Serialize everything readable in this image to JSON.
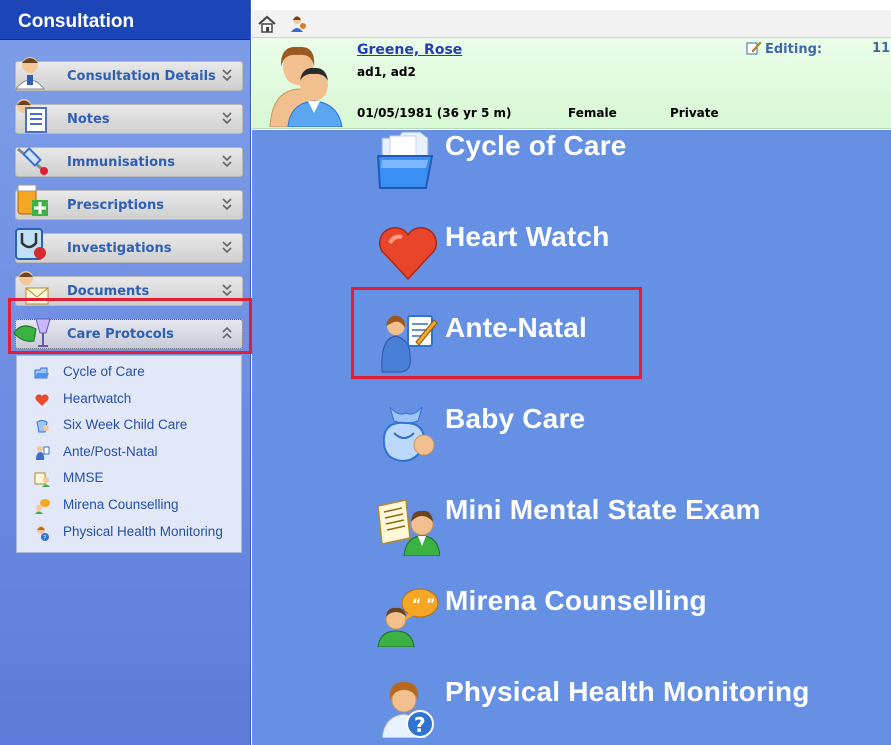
{
  "sidebar": {
    "title": "Consultation",
    "items": [
      {
        "label": "Consultation Details",
        "icon": "doctor-icon"
      },
      {
        "label": "Notes",
        "icon": "notes-icon"
      },
      {
        "label": "Immunisations",
        "icon": "syringe-icon"
      },
      {
        "label": "Prescriptions",
        "icon": "prescription-icon"
      },
      {
        "label": "Investigations",
        "icon": "stethoscope-icon"
      },
      {
        "label": "Documents",
        "icon": "documents-icon"
      },
      {
        "label": "Care Protocols",
        "icon": "care-protocols-icon",
        "expanded": true
      }
    ],
    "care_protocols": [
      {
        "label": "Cycle of Care",
        "icon": "folder-icon"
      },
      {
        "label": "Heartwatch",
        "icon": "heart-icon"
      },
      {
        "label": "Six Week Child Care",
        "icon": "baby-icon"
      },
      {
        "label": "Ante/Post-Natal",
        "icon": "mother-icon"
      },
      {
        "label": "MMSE",
        "icon": "exam-icon"
      },
      {
        "label": "Mirena Counselling",
        "icon": "speech-icon"
      },
      {
        "label": "Physical Health Monitoring",
        "icon": "health-help-icon"
      }
    ]
  },
  "toolbar": {
    "icons": [
      "home-icon",
      "patient-icon"
    ]
  },
  "patient": {
    "name": "Greene, Rose",
    "address": "ad1, ad2",
    "dob": "01/05/1981 (36 yr 5 m)",
    "sex": "Female",
    "billing": "Private",
    "editing_label": "Editing:",
    "editing_value": "11"
  },
  "protocols": [
    {
      "label": "Cycle of Care",
      "icon": "folder-icon"
    },
    {
      "label": "Heart Watch",
      "icon": "heart-icon"
    },
    {
      "label": "Ante-Natal",
      "icon": "mother-icon"
    },
    {
      "label": "Baby Care",
      "icon": "baby-icon"
    },
    {
      "label": "Mini Mental State Exam",
      "icon": "exam-icon"
    },
    {
      "label": "Mirena Counselling",
      "icon": "speech-icon"
    },
    {
      "label": "Physical Health Monitoring",
      "icon": "health-help-icon"
    }
  ],
  "colors": {
    "accent": "#1c46b8",
    "main_bg": "#6690e4",
    "highlight": "#e01e35",
    "header_bg": "#d7f7d3"
  }
}
